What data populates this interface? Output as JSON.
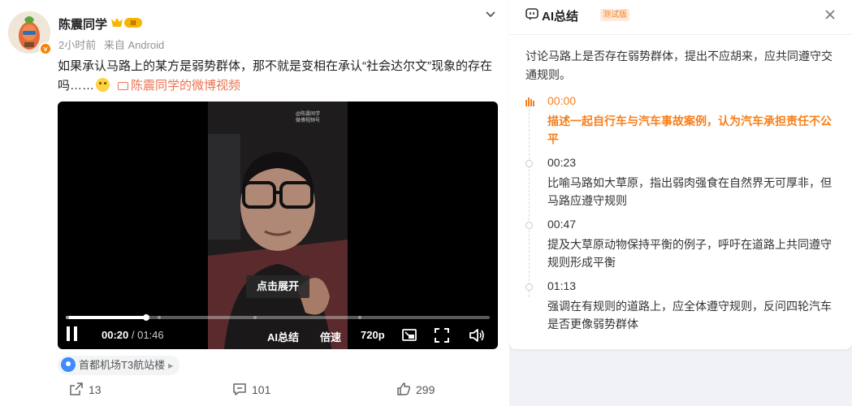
{
  "post": {
    "username": "陈震同学",
    "vip_badge": "III",
    "verified_mark": "v",
    "time": "2小时前",
    "source": "来自 Android",
    "text": "如果承认马路上的某方是弱势群体，那不就是变相在承认“社会达尔文”现象的存在吗……",
    "video_link": "陈震同学的微博视频",
    "location": "首都机场T3航站楼",
    "actions": {
      "share": "13",
      "comment": "101",
      "like": "299"
    }
  },
  "video": {
    "watermark": "@陈震同学",
    "watermark_sub": "微博视频号",
    "expand_tip": "点击展开",
    "current_time": "00:20",
    "duration": "/ 01:46",
    "progress_fraction": 0.189,
    "chapter_markers": [
      0.0,
      0.217,
      0.443,
      0.69
    ],
    "ai_summary_button": "AI总结",
    "speed_button": "倍速",
    "quality_button": "720p"
  },
  "ai_panel": {
    "title": "AI总结",
    "beta_tag": "测试版",
    "summary": "讨论马路上是否存在弱势群体，提出不应胡来，应共同遵守交通规则。",
    "chapters": [
      {
        "time": "00:00",
        "text": "描述一起自行车与汽车事故案例，认为汽车承担责任不公平",
        "active": true
      },
      {
        "time": "00:23",
        "text": "比喻马路如大草原，指出弱肉强食在自然界无可厚非，但马路应遵守规则",
        "active": false
      },
      {
        "time": "00:47",
        "text": "提及大草原动物保持平衡的例子，呼吁在道路上共同遵守规则形成平衡",
        "active": false
      },
      {
        "time": "01:13",
        "text": "强调在有规则的道路上，应全体遵守规则，反问四轮汽车是否更像弱势群体",
        "active": false
      }
    ]
  },
  "colors": {
    "accent": "#f7801e",
    "link": "#eb7350",
    "pin": "#3d8bfd"
  },
  "icons": [
    "chevron-down-icon",
    "pause-icon",
    "pip-icon",
    "fullscreen-icon",
    "volume-icon",
    "location-pin-icon",
    "share-icon",
    "comment-icon",
    "like-icon",
    "ai-logo-icon",
    "close-icon",
    "waveform-icon"
  ]
}
